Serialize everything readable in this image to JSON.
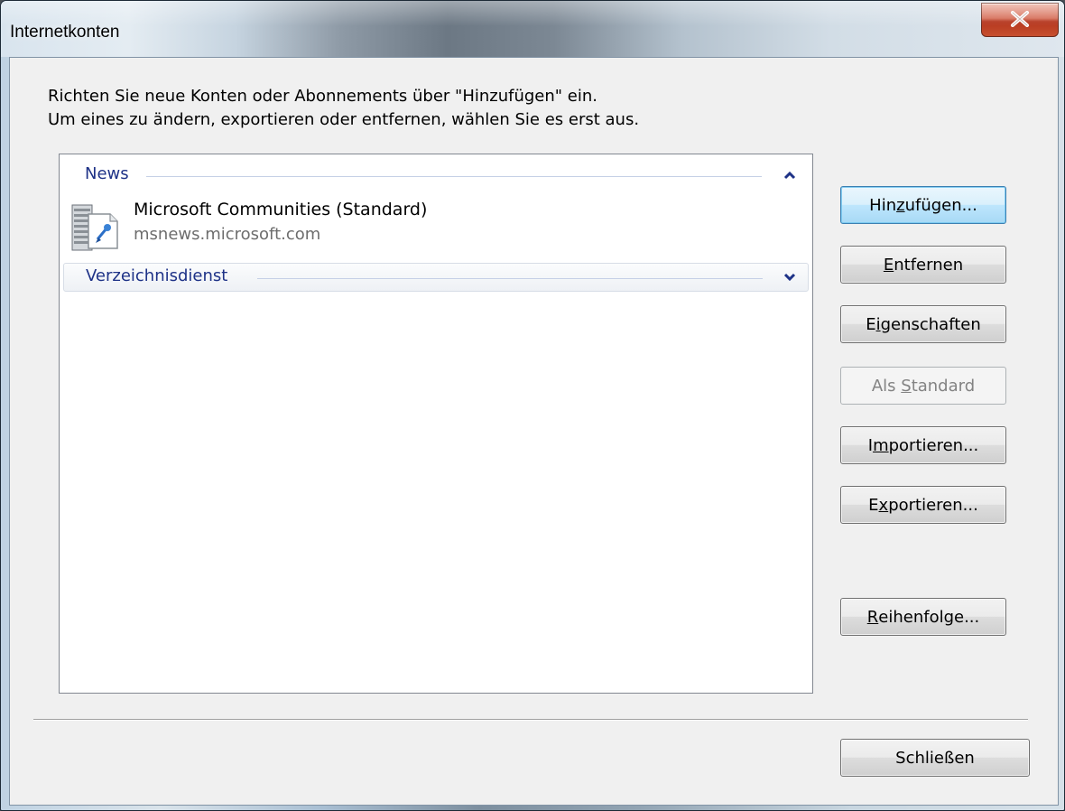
{
  "window": {
    "title": "Internetkonten",
    "close_label": "X"
  },
  "instructions": {
    "line1": "Richten Sie neue Konten oder Abonnements über \"Hinzufügen\" ein.",
    "line2": "Um eines zu ändern, exportieren oder entfernen, wählen Sie es erst aus."
  },
  "accounts_list": {
    "groups": [
      {
        "label": "News",
        "state": "expanded",
        "chevron_icon": "chevron-up-icon",
        "items": [
          {
            "icon": "news-server-icon",
            "name": "Microsoft Communities (Standard)",
            "server": "msnews.microsoft.com"
          }
        ]
      },
      {
        "label": "Verzeichnisdienst",
        "state": "collapsed",
        "chevron_icon": "chevron-down-icon",
        "items": []
      }
    ]
  },
  "buttons": {
    "add": {
      "pre": "Hin",
      "key": "z",
      "post": "ufügen...",
      "state": "default"
    },
    "remove": {
      "pre": "",
      "key": "E",
      "post": "ntfernen",
      "state": "enabled"
    },
    "properties": {
      "pre": "E",
      "key": "i",
      "post": "genschaften",
      "state": "enabled"
    },
    "set_default": {
      "pre": "Als ",
      "key": "S",
      "post": "tandard",
      "state": "disabled"
    },
    "import": {
      "pre": "I",
      "key": "m",
      "post": "portieren...",
      "state": "enabled"
    },
    "export": {
      "pre": "E",
      "key": "x",
      "post": "portieren...",
      "state": "enabled"
    },
    "order": {
      "pre": "",
      "key": "R",
      "post": "eihenfolge...",
      "state": "enabled"
    },
    "close": {
      "label": "Schließen",
      "state": "enabled"
    }
  },
  "colors": {
    "group_header_text": "#1e3287",
    "default_button_border": "#3c7fb1",
    "close_button_red": "#c7502f"
  }
}
